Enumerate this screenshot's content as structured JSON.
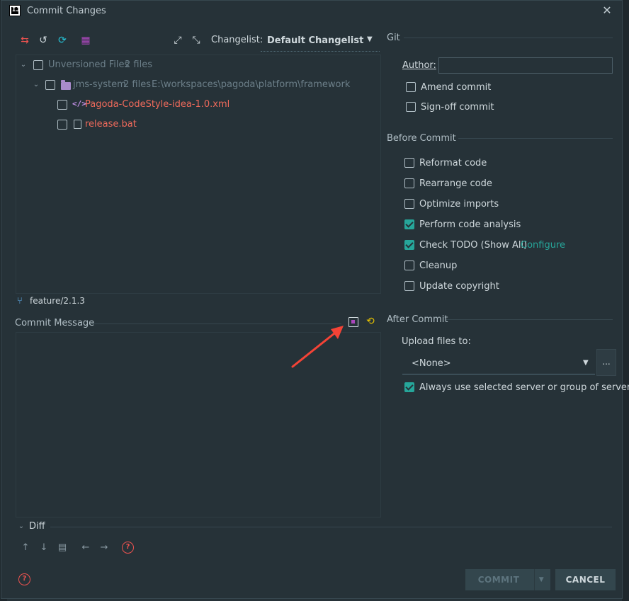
{
  "window": {
    "title": "Commit Changes"
  },
  "toolbar": {
    "changelist_label": "Changelist:",
    "changelist_value": "Default Changelist"
  },
  "tree": {
    "root": {
      "label": "Unversioned Files",
      "count": "2 files"
    },
    "group": {
      "label": "jms-system",
      "count": "2 files",
      "path": "E:\\workspaces\\pagoda\\platform\\framework"
    },
    "files": [
      {
        "name": "Pagoda-CodeStyle-idea-1.0.xml"
      },
      {
        "name": "release.bat"
      }
    ]
  },
  "branch": "feature/2.1.3",
  "commit_message": {
    "label": "Commit Message"
  },
  "git": {
    "section": "Git",
    "author_label": "Author:",
    "author_value": "",
    "amend": "Amend commit",
    "signoff": "Sign-off commit"
  },
  "before_commit": {
    "section": "Before Commit",
    "items": [
      {
        "label": "Reformat code",
        "checked": false
      },
      {
        "label": "Rearrange code",
        "checked": false
      },
      {
        "label": "Optimize imports",
        "checked": false
      },
      {
        "label": "Perform code analysis",
        "checked": true
      },
      {
        "label": "Check TODO (Show All)",
        "checked": true
      },
      {
        "label": "Cleanup",
        "checked": false
      },
      {
        "label": "Update copyright",
        "checked": false
      }
    ],
    "configure": "Configure"
  },
  "after_commit": {
    "section": "After Commit",
    "upload_label": "Upload files to:",
    "upload_value": "<None>",
    "ellipsis": "...",
    "always_use": "Always use selected server or group of servers"
  },
  "diff": {
    "label": "Diff"
  },
  "buttons": {
    "commit": "COMMIT",
    "cancel": "CANCEL"
  },
  "colors": {
    "accent": "#26a69a",
    "unversioned": "#ef6a5b",
    "arrow": "#f44336"
  }
}
